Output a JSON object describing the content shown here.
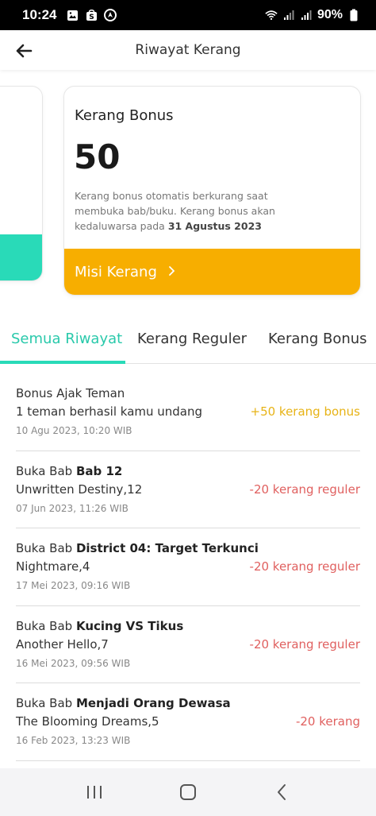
{
  "status_bar": {
    "time": "10:24",
    "battery": "90%"
  },
  "header": {
    "title": "Riwayat Kerang"
  },
  "bonus_card": {
    "title": "Kerang Bonus",
    "amount": "50",
    "description": "Kerang bonus otomatis berkurang saat membuka bab/buku. Kerang bonus akan kedaluwarsa pada ",
    "expiry_date": "31 Agustus 2023",
    "mission_label": "Misi Kerang"
  },
  "tabs": [
    "Semua Riwayat",
    "Kerang Reguler",
    "Kerang Bonus"
  ],
  "history": [
    {
      "title_prefix": "Bonus Ajak Teman",
      "title_bold": "",
      "subtitle": "1 teman berhasil kamu undang",
      "date": "10 Agu 2023, 10:20 WIB",
      "amount": "+50 kerang bonus"
    },
    {
      "title_prefix": "Buka Bab ",
      "title_bold": "Bab 12",
      "subtitle": "Unwritten Destiny,12",
      "date": "07 Jun 2023, 11:26 WIB",
      "amount": "-20 kerang reguler"
    },
    {
      "title_prefix": "Buka Bab ",
      "title_bold": "District 04: Target Terkunci",
      "subtitle": "Nightmare,4",
      "date": "17 Mei 2023, 09:16 WIB",
      "amount": "-20 kerang reguler"
    },
    {
      "title_prefix": "Buka Bab ",
      "title_bold": "Kucing VS Tikus",
      "subtitle": "Another Hello,7",
      "date": "16 Mei 2023, 09:56 WIB",
      "amount": "-20 kerang reguler"
    },
    {
      "title_prefix": "Buka Bab ",
      "title_bold": "Menjadi Orang Dewasa",
      "subtitle": "The Blooming Dreams,5",
      "date": "16 Feb 2023, 13:23 WIB",
      "amount": "-20 kerang"
    }
  ],
  "colors": {
    "accent_teal": "#29dab8",
    "mission_orange": "#f7ae00",
    "bonus_amount": "#e7b316",
    "negative_amount": "#e0605f"
  }
}
